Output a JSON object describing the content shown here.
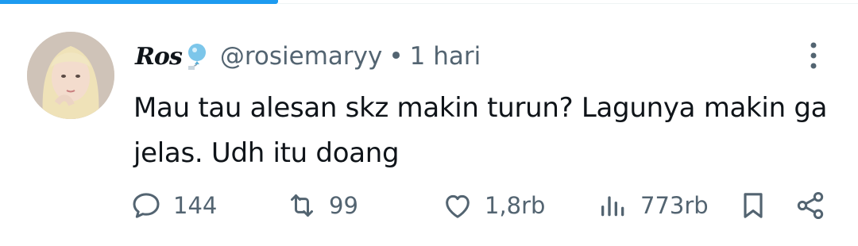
{
  "tweet": {
    "display_name": "Ros",
    "name_emoji": "balloon-emoji",
    "handle": "@rosiemaryy",
    "separator": "•",
    "time": "1 hari",
    "text": "Mau tau alesan skz makin turun? Lagunya makin ga jelas. Udh itu doang"
  },
  "actions": {
    "replies": "144",
    "retweets": "99",
    "likes": "1,8rb",
    "views": "773rb"
  },
  "icons": [
    "reply-icon",
    "retweet-icon",
    "like-icon",
    "views-icon",
    "bookmark-icon",
    "share-icon",
    "more-icon"
  ],
  "colors": {
    "accent": "#1d9bf0",
    "text": "#0f1419",
    "muted": "#536471"
  }
}
